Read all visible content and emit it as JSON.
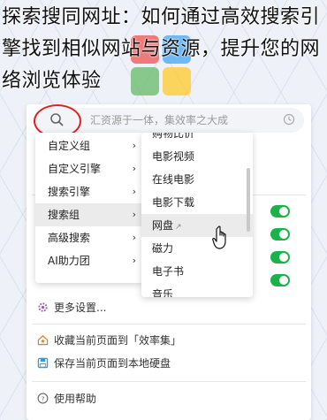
{
  "headline": "探索搜同网址：如何通过高效搜索引擎找到相似网站与资源，提升您的网络浏览体验",
  "search": {
    "placeholder": "汇资源于一体，集效率之大成"
  },
  "menu_level1": {
    "items": [
      {
        "label": "自定义组",
        "arrow": "›"
      },
      {
        "label": "自定义引擎",
        "arrow": "›"
      },
      {
        "label": "搜索引擎",
        "arrow": "›"
      },
      {
        "label": "搜索组",
        "arrow": "›"
      },
      {
        "label": "高级搜索",
        "arrow": "›"
      },
      {
        "label": "AI助力团",
        "arrow": "›"
      }
    ],
    "active_index": 3
  },
  "menu_level2": {
    "items": [
      {
        "label": "购物比价"
      },
      {
        "label": "电影视频"
      },
      {
        "label": "在线电影"
      },
      {
        "label": "电影下载"
      },
      {
        "label": "网盘"
      },
      {
        "label": "磁力"
      },
      {
        "label": "电子书"
      },
      {
        "label": "音乐"
      }
    ],
    "active_index": 4,
    "external_mark": "↗"
  },
  "options": {
    "more_settings": "更多设置...",
    "bookmark_to_collection": "收藏当前页面到「效率集」",
    "save_local": "保存当前页面到本地硬盘",
    "help": "使用帮助"
  },
  "toggles": [
    true,
    true,
    true,
    true
  ],
  "colors": {
    "accent": "#19b34a",
    "highlight_ring": "#e02020"
  }
}
